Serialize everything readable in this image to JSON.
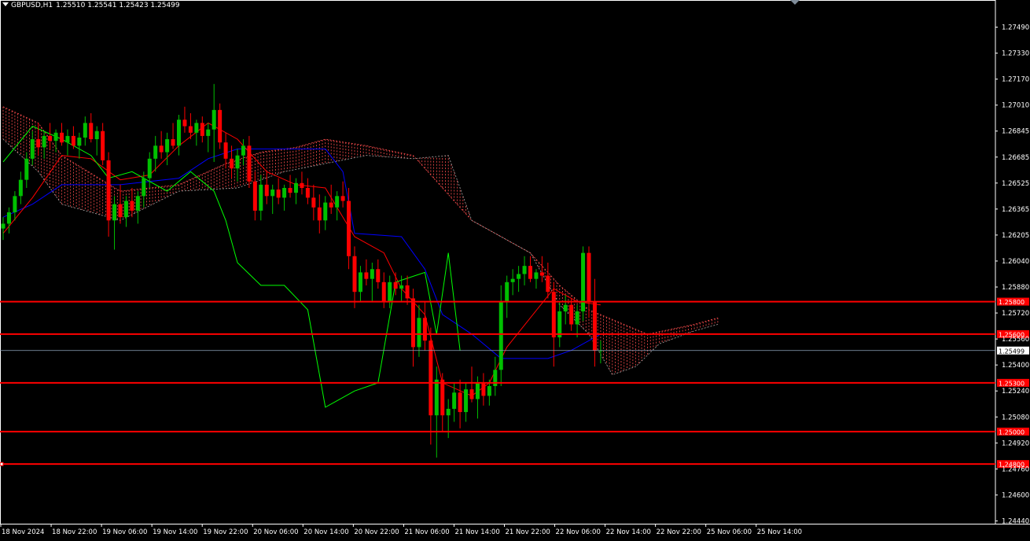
{
  "header": {
    "symbol": "GBPUSD,H1",
    "ohlc": "1.25510 1.25541 1.25423 1.25499"
  },
  "colors": {
    "background": "#000000",
    "foreground": "#ffffff",
    "bull_candle": "#00c000",
    "bear_candle": "#ff0000",
    "tenkan": "#ff0000",
    "kijun": "#0000ff",
    "chikou": "#00ff00",
    "cloud": "#ff4d4d",
    "level_line": "#ff0000",
    "bid_line": "#8fa7bf"
  },
  "chart_data": {
    "type": "candlestick",
    "symbol": "GBPUSD",
    "timeframe": "H1",
    "ylim": [
      1.2444,
      1.2765
    ],
    "y_ticks": [
      "1.27490",
      "1.27330",
      "1.27170",
      "1.27010",
      "1.26845",
      "1.26685",
      "1.26525",
      "1.26365",
      "1.26205",
      "1.26040",
      "1.25880",
      "1.25720",
      "1.25560",
      "1.25400",
      "1.25240",
      "1.25080",
      "1.24920",
      "1.24760",
      "1.24600",
      "1.24440"
    ],
    "x_ticks": [
      "18 Nov 2024",
      "18 Nov 22:00",
      "19 Nov 06:00",
      "19 Nov 14:00",
      "19 Nov 22:00",
      "20 Nov 06:00",
      "20 Nov 14:00",
      "20 Nov 22:00",
      "21 Nov 06:00",
      "21 Nov 14:00",
      "21 Nov 22:00",
      "22 Nov 06:00",
      "22 Nov 14:00",
      "22 Nov 22:00",
      "25 Nov 06:00",
      "25 Nov 14:00"
    ],
    "current_price": {
      "value": 1.25499,
      "label": "1.25499"
    },
    "levels": [
      {
        "value": 1.258,
        "label": "1.25800"
      },
      {
        "value": 1.256,
        "label": "1.25600"
      },
      {
        "value": 1.253,
        "label": "1.25300"
      },
      {
        "value": 1.25,
        "label": "1.25000"
      },
      {
        "value": 1.248,
        "label": "1.24800"
      }
    ],
    "candles": [
      [
        1.2625,
        1.2632,
        1.2618,
        1.2628
      ],
      [
        1.2628,
        1.2638,
        1.2622,
        1.2635
      ],
      [
        1.2635,
        1.2648,
        1.263,
        1.2645
      ],
      [
        1.2645,
        1.266,
        1.264,
        1.2655
      ],
      [
        1.2655,
        1.2672,
        1.265,
        1.2668
      ],
      [
        1.2668,
        1.2685,
        1.2664,
        1.268
      ],
      [
        1.268,
        1.269,
        1.267,
        1.2675
      ],
      [
        1.2675,
        1.2685,
        1.2668,
        1.2682
      ],
      [
        1.2682,
        1.269,
        1.2674,
        1.2679
      ],
      [
        1.2679,
        1.2686,
        1.2672,
        1.2684
      ],
      [
        1.2684,
        1.269,
        1.2676,
        1.2678
      ],
      [
        1.2678,
        1.2686,
        1.267,
        1.2682
      ],
      [
        1.2682,
        1.2688,
        1.2674,
        1.2676
      ],
      [
        1.2676,
        1.2684,
        1.2668,
        1.2681
      ],
      [
        1.2681,
        1.2694,
        1.2676,
        1.269
      ],
      [
        1.269,
        1.2696,
        1.2678,
        1.268
      ],
      [
        1.268,
        1.2688,
        1.267,
        1.2685
      ],
      [
        1.2685,
        1.269,
        1.2664,
        1.2667
      ],
      [
        1.2667,
        1.2672,
        1.262,
        1.263
      ],
      [
        1.263,
        1.2645,
        1.2612,
        1.264
      ],
      [
        1.264,
        1.2652,
        1.2628,
        1.2632
      ],
      [
        1.2632,
        1.2645,
        1.2626,
        1.2642
      ],
      [
        1.2642,
        1.265,
        1.2632,
        1.2636
      ],
      [
        1.2636,
        1.2648,
        1.2628,
        1.2645
      ],
      [
        1.2645,
        1.266,
        1.2638,
        1.2656
      ],
      [
        1.2656,
        1.2672,
        1.265,
        1.2668
      ],
      [
        1.2668,
        1.2682,
        1.266,
        1.2676
      ],
      [
        1.2676,
        1.2685,
        1.2668,
        1.2672
      ],
      [
        1.2672,
        1.2684,
        1.2664,
        1.268
      ],
      [
        1.268,
        1.269,
        1.2674,
        1.2676
      ],
      [
        1.2676,
        1.2695,
        1.267,
        1.2692
      ],
      [
        1.2692,
        1.27,
        1.2684,
        1.2688
      ],
      [
        1.2688,
        1.2696,
        1.268,
        1.2684
      ],
      [
        1.2684,
        1.2692,
        1.2676,
        1.269
      ],
      [
        1.269,
        1.2694,
        1.2678,
        1.2682
      ],
      [
        1.2682,
        1.269,
        1.2672,
        1.2686
      ],
      [
        1.2686,
        1.2714,
        1.2666,
        1.2698
      ],
      [
        1.2698,
        1.2702,
        1.2674,
        1.2678
      ],
      [
        1.2678,
        1.2684,
        1.2662,
        1.2668
      ],
      [
        1.2668,
        1.2676,
        1.2656,
        1.2662
      ],
      [
        1.2662,
        1.2674,
        1.2654,
        1.267
      ],
      [
        1.267,
        1.268,
        1.2664,
        1.2676
      ],
      [
        1.2676,
        1.2682,
        1.265,
        1.2654
      ],
      [
        1.2654,
        1.266,
        1.263,
        1.2636
      ],
      [
        1.2636,
        1.2658,
        1.263,
        1.2652
      ],
      [
        1.2652,
        1.266,
        1.264,
        1.2645
      ],
      [
        1.2645,
        1.2652,
        1.2634,
        1.2649
      ],
      [
        1.2649,
        1.2656,
        1.264,
        1.2644
      ],
      [
        1.2644,
        1.2652,
        1.2636,
        1.265
      ],
      [
        1.265,
        1.2658,
        1.2644,
        1.2647
      ],
      [
        1.2647,
        1.2656,
        1.264,
        1.2653
      ],
      [
        1.2653,
        1.266,
        1.2646,
        1.265
      ],
      [
        1.265,
        1.2656,
        1.264,
        1.2644
      ],
      [
        1.2644,
        1.2652,
        1.263,
        1.2638
      ],
      [
        1.2638,
        1.2646,
        1.2622,
        1.263
      ],
      [
        1.263,
        1.2645,
        1.2624,
        1.2641
      ],
      [
        1.2641,
        1.2652,
        1.2634,
        1.2638
      ],
      [
        1.2638,
        1.2648,
        1.263,
        1.2645
      ],
      [
        1.2645,
        1.2654,
        1.2638,
        1.2642
      ],
      [
        1.2642,
        1.265,
        1.26,
        1.2608
      ],
      [
        1.2608,
        1.2614,
        1.2576,
        1.2586
      ],
      [
        1.2586,
        1.2602,
        1.258,
        1.2598
      ],
      [
        1.2598,
        1.2606,
        1.259,
        1.2594
      ],
      [
        1.2594,
        1.2604,
        1.258,
        1.26
      ],
      [
        1.26,
        1.2606,
        1.2588,
        1.2592
      ],
      [
        1.2592,
        1.2598,
        1.2576,
        1.258
      ],
      [
        1.258,
        1.2596,
        1.2576,
        1.2592
      ],
      [
        1.2592,
        1.2598,
        1.2584,
        1.2588
      ],
      [
        1.2588,
        1.2596,
        1.258,
        1.259
      ],
      [
        1.259,
        1.2596,
        1.2578,
        1.2582
      ],
      [
        1.2582,
        1.2588,
        1.254,
        1.2552
      ],
      [
        1.2552,
        1.2578,
        1.2546,
        1.257
      ],
      [
        1.257,
        1.258,
        1.255,
        1.2556
      ],
      [
        1.2556,
        1.2564,
        1.2492,
        1.251
      ],
      [
        1.251,
        1.254,
        1.2484,
        1.2532
      ],
      [
        1.2532,
        1.2536,
        1.25,
        1.251
      ],
      [
        1.251,
        1.252,
        1.2496,
        1.2514
      ],
      [
        1.2514,
        1.253,
        1.2506,
        1.2524
      ],
      [
        1.2524,
        1.2532,
        1.2502,
        1.2512
      ],
      [
        1.2512,
        1.253,
        1.2506,
        1.2526
      ],
      [
        1.2526,
        1.254,
        1.2518,
        1.252
      ],
      [
        1.252,
        1.2534,
        1.2508,
        1.253
      ],
      [
        1.253,
        1.2536,
        1.2516,
        1.2522
      ],
      [
        1.2522,
        1.2532,
        1.2516,
        1.2528
      ],
      [
        1.2528,
        1.2546,
        1.2522,
        1.2538
      ],
      [
        1.2538,
        1.259,
        1.2528,
        1.258
      ],
      [
        1.258,
        1.2596,
        1.257,
        1.2592
      ],
      [
        1.2592,
        1.26,
        1.2584,
        1.2594
      ],
      [
        1.2594,
        1.2602,
        1.2586,
        1.2597
      ],
      [
        1.2597,
        1.2608,
        1.259,
        1.2602
      ],
      [
        1.2602,
        1.2608,
        1.2592,
        1.2594
      ],
      [
        1.2594,
        1.26,
        1.2588,
        1.2598
      ],
      [
        1.2598,
        1.2608,
        1.2592,
        1.2596
      ],
      [
        1.2596,
        1.2604,
        1.2582,
        1.2586
      ],
      [
        1.2586,
        1.2592,
        1.254,
        1.2558
      ],
      [
        1.2558,
        1.258,
        1.2552,
        1.2574
      ],
      [
        1.2574,
        1.2584,
        1.2566,
        1.2578
      ],
      [
        1.2578,
        1.2582,
        1.2562,
        1.2566
      ],
      [
        1.2566,
        1.2578,
        1.2558,
        1.2574
      ],
      [
        1.2574,
        1.2614,
        1.2568,
        1.261
      ],
      [
        1.261,
        1.2614,
        1.257,
        1.258
      ],
      [
        1.258,
        1.2594,
        1.254,
        1.255
      ],
      [
        1.255,
        1.2556,
        1.2542,
        1.255
      ]
    ],
    "tenkan": [
      [
        0,
        1.2622
      ],
      [
        5,
        1.2644
      ],
      [
        10,
        1.267
      ],
      [
        15,
        1.2668
      ],
      [
        20,
        1.2655
      ],
      [
        25,
        1.2658
      ],
      [
        30,
        1.2676
      ],
      [
        35,
        1.269
      ],
      [
        40,
        1.268
      ],
      [
        45,
        1.266
      ],
      [
        50,
        1.2652
      ],
      [
        55,
        1.265
      ],
      [
        60,
        1.262
      ],
      [
        65,
        1.261
      ],
      [
        68,
        1.2588
      ],
      [
        72,
        1.2572
      ],
      [
        75,
        1.253
      ],
      [
        80,
        1.2522
      ],
      [
        83,
        1.253
      ],
      [
        86,
        1.2552
      ],
      [
        90,
        1.257
      ],
      [
        94,
        1.2588
      ],
      [
        98,
        1.258
      ],
      [
        102,
        1.2578
      ]
    ],
    "kijun": [
      [
        0,
        1.2632
      ],
      [
        5,
        1.264
      ],
      [
        10,
        1.2652
      ],
      [
        20,
        1.2652
      ],
      [
        30,
        1.2656
      ],
      [
        35,
        1.2668
      ],
      [
        40,
        1.2674
      ],
      [
        55,
        1.2674
      ],
      [
        58,
        1.266
      ],
      [
        60,
        1.2622
      ],
      [
        68,
        1.262
      ],
      [
        72,
        1.26
      ],
      [
        75,
        1.2572
      ],
      [
        80,
        1.256
      ],
      [
        85,
        1.2545
      ],
      [
        93,
        1.2545
      ],
      [
        97,
        1.255
      ],
      [
        102,
        1.256
      ]
    ],
    "chikou": [
      [
        0,
        1.2666
      ],
      [
        5,
        1.2688
      ],
      [
        10,
        1.268
      ],
      [
        15,
        1.267
      ],
      [
        18,
        1.2656
      ],
      [
        22,
        1.266
      ],
      [
        28,
        1.2648
      ],
      [
        32,
        1.266
      ],
      [
        36,
        1.2648
      ],
      [
        38,
        1.263
      ],
      [
        40,
        1.2604
      ],
      [
        44,
        1.259
      ],
      [
        48,
        1.259
      ],
      [
        52,
        1.2575
      ],
      [
        55,
        1.2515
      ],
      [
        60,
        1.2525
      ],
      [
        64,
        1.253
      ],
      [
        67,
        1.2592
      ],
      [
        72,
        1.2598
      ],
      [
        74,
        1.256
      ],
      [
        76,
        1.261
      ],
      [
        78,
        1.255
      ]
    ],
    "cloud_span_a": [
      [
        0,
        1.27
      ],
      [
        6,
        1.269
      ],
      [
        10,
        1.267
      ],
      [
        20,
        1.2648
      ],
      [
        30,
        1.2652
      ],
      [
        38,
        1.2665
      ],
      [
        44,
        1.2672
      ],
      [
        50,
        1.2675
      ],
      [
        55,
        1.268
      ],
      [
        62,
        1.2676
      ],
      [
        70,
        1.267
      ],
      [
        80,
        1.263
      ],
      [
        90,
        1.261
      ],
      [
        95,
        1.259
      ],
      [
        100,
        1.2575
      ],
      [
        110,
        1.256
      ],
      [
        118,
        1.2566
      ],
      [
        122,
        1.257
      ]
    ],
    "cloud_span_b": [
      [
        0,
        1.268
      ],
      [
        6,
        1.266
      ],
      [
        10,
        1.264
      ],
      [
        20,
        1.263
      ],
      [
        30,
        1.2648
      ],
      [
        40,
        1.265
      ],
      [
        48,
        1.266
      ],
      [
        55,
        1.2665
      ],
      [
        62,
        1.267
      ],
      [
        70,
        1.2668
      ],
      [
        76,
        1.267
      ],
      [
        80,
        1.263
      ],
      [
        90,
        1.261
      ],
      [
        95,
        1.2578
      ],
      [
        100,
        1.256
      ],
      [
        104,
        1.2535
      ],
      [
        108,
        1.254
      ],
      [
        112,
        1.2554
      ],
      [
        118,
        1.2562
      ],
      [
        122,
        1.2566
      ]
    ]
  }
}
